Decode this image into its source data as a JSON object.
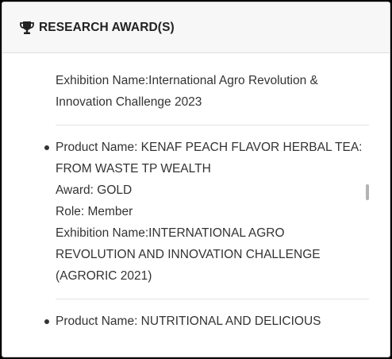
{
  "header": {
    "title": "RESEARCH AWARD(S)",
    "icon": "trophy-icon"
  },
  "awards": [
    {
      "lines": [
        "Exhibition Name:International Agro Revolution &",
        "Innovation Challenge 2023"
      ]
    },
    {
      "lines": [
        "Product Name: KENAF PEACH FLAVOR HERBAL TEA:",
        "FROM WASTE TP WEALTH",
        "Award: GOLD",
        "Role: Member",
        "Exhibition Name:INTERNATIONAL AGRO",
        "REVOLUTION AND INNOVATION CHALLENGE",
        "(AGRORIC 2021)"
      ]
    },
    {
      "lines": [
        "Product Name: NUTRITIONAL AND DELICIOUS"
      ]
    }
  ]
}
